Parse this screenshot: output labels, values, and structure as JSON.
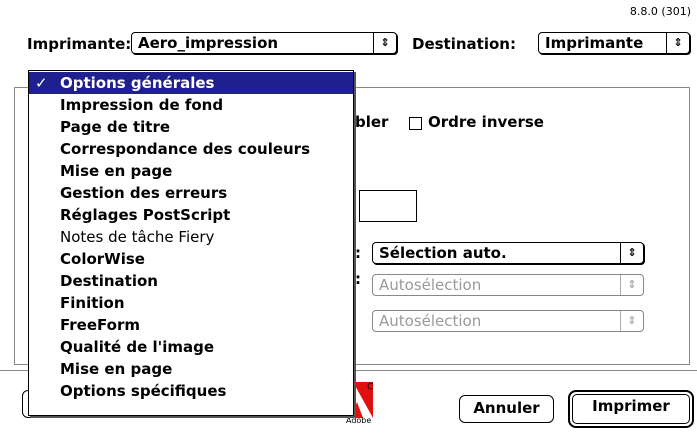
{
  "version": "8.8.0 (301)",
  "printer": {
    "label": "Imprimante:",
    "value": "Aero_impression"
  },
  "destination": {
    "label": "Destination:",
    "value": "Imprimante"
  },
  "checkbox_reverse_label": "Ordre inverse",
  "partial_label_assemble": "bler",
  "popups": [
    {
      "value": "Sélection auto.",
      "enabled": true
    },
    {
      "value": "Autosélection",
      "enabled": false
    },
    {
      "value": "Autosélection",
      "enabled": false
    }
  ],
  "popup_label_fragments": [
    ":",
    ":"
  ],
  "menu": {
    "items": [
      {
        "label": "Options générales",
        "selected": true,
        "checked": true
      },
      {
        "label": "Impression de fond"
      },
      {
        "label": "Page de titre"
      },
      {
        "label": "Correspondance des couleurs"
      },
      {
        "label": "Mise en page"
      },
      {
        "label": "Gestion des erreurs"
      },
      {
        "label": "Réglages PostScript"
      },
      {
        "label": "Notes de tâche Fiery",
        "plain": true
      },
      {
        "label": "ColorWise"
      },
      {
        "label": "Destination"
      },
      {
        "label": "Finition"
      },
      {
        "label": "FreeForm"
      },
      {
        "label": "Qualité de l'image"
      },
      {
        "label": "Mise en page"
      },
      {
        "label": "Options spécifiques"
      }
    ],
    "check_glyph": "✓"
  },
  "buttons": {
    "cancel": "Annuler",
    "print": "Imprimer"
  },
  "logo_text": "Adobe",
  "colors": {
    "menu_highlight": "#1f1f8f",
    "logo_red": "#e01010"
  },
  "icons": {
    "popup_arrow": "updown-arrows-icon"
  }
}
